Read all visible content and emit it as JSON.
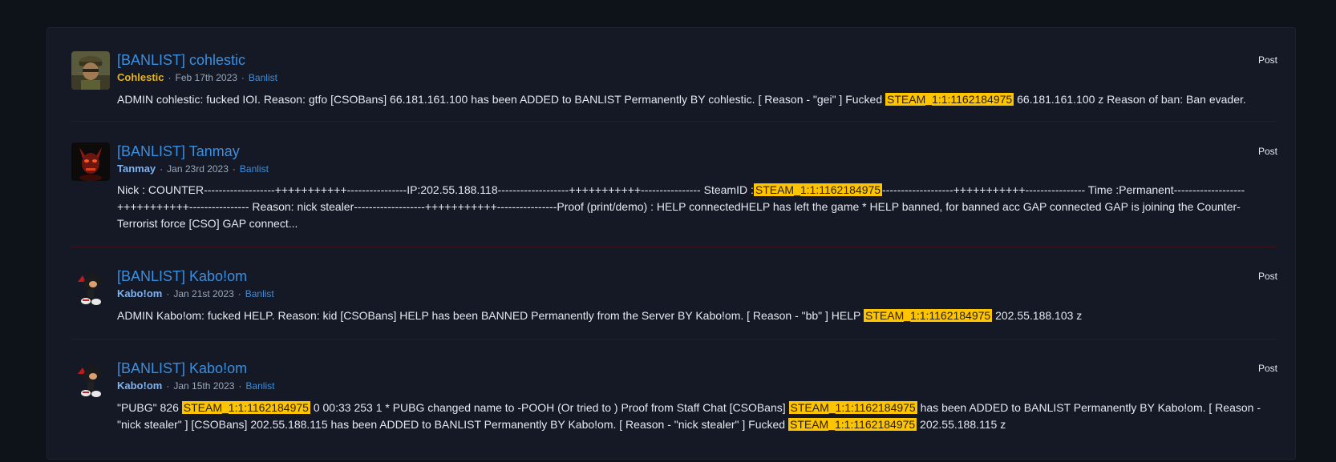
{
  "results": [
    {
      "title": "[BANLIST] cohlestic",
      "user": "Cohlestic",
      "date": "Feb 17th 2023",
      "forum": "Banlist",
      "type": "Post",
      "snippet": [
        "ADMIN cohlestic: fucked IOI. Reason: gtfo [CSOBans] 66.181.161.100 has been ADDED to BANLIST Permanently BY cohlestic. [ Reason - \"gei\" ] Fucked ",
        "STEAM_1:1:1162184975",
        " 66.181.161.100 z Reason of ban: Ban evader."
      ]
    },
    {
      "title": "[BANLIST] Tanmay",
      "user": "Tanmay",
      "date": "Jan 23rd 2023",
      "forum": "Banlist",
      "type": "Post",
      "snippet": [
        "Nick : COUNTER-------------------+++++++++++----------------IP:202.55.188.118-------------------+++++++++++---------------- SteamID :",
        "STEAM_1:1:1162184975",
        "-------------------+++++++++++---------------- Time :Permanent-------------------+++++++++++---------------- Reason: nick stealer-------------------+++++++++++----------------Proof (print/demo) : HELP connectedHELP has left the game * HELP banned, for banned acc GAP connected GAP is joining the Counter-Terrorist force [CSO] GAP connect..."
      ]
    },
    {
      "title": "[BANLIST] Kabo!om",
      "user": "Kabo!om",
      "date": "Jan 21st 2023",
      "forum": "Banlist",
      "type": "Post",
      "snippet": [
        "ADMIN Kabo!om: fucked HELP. Reason: kid [CSOBans] HELP has been BANNED Permanently from the Server BY Kabo!om. [ Reason - \"bb\" ] HELP ",
        "STEAM_1:1:1162184975",
        " 202.55.188.103 z"
      ]
    },
    {
      "title": "[BANLIST] Kabo!om",
      "user": "Kabo!om",
      "date": "Jan 15th 2023",
      "forum": "Banlist",
      "type": "Post",
      "snippet": [
        "\"PUBG\" 826 ",
        "STEAM_1:1:1162184975",
        " 0 00:33 253 1 * PUBG changed name to -POOH (Or tried to ) Proof from Staff Chat [CSOBans] ",
        "STEAM_1:1:1162184975",
        " has been ADDED to BANLIST Permanently BY Kabo!om. [ Reason - \"nick stealer\" ] [CSOBans] 202.55.188.115 has been ADDED to BANLIST Permanently BY Kabo!om. [ Reason - \"nick stealer\" ] Fucked ",
        "STEAM_1:1:1162184975",
        " 202.55.188.115 z"
      ]
    }
  ],
  "colors": {
    "background": "#0e1219",
    "panel": "#141925",
    "link": "#3b8fe0",
    "username": "#7fb2ee",
    "username_gold": "#e8b31b",
    "highlight": "#ffc400",
    "divider": "#3a1418"
  },
  "avatars": [
    "soldier-avatar",
    "demon-avatar",
    "hedgehog-avatar",
    "hedgehog-avatar"
  ]
}
